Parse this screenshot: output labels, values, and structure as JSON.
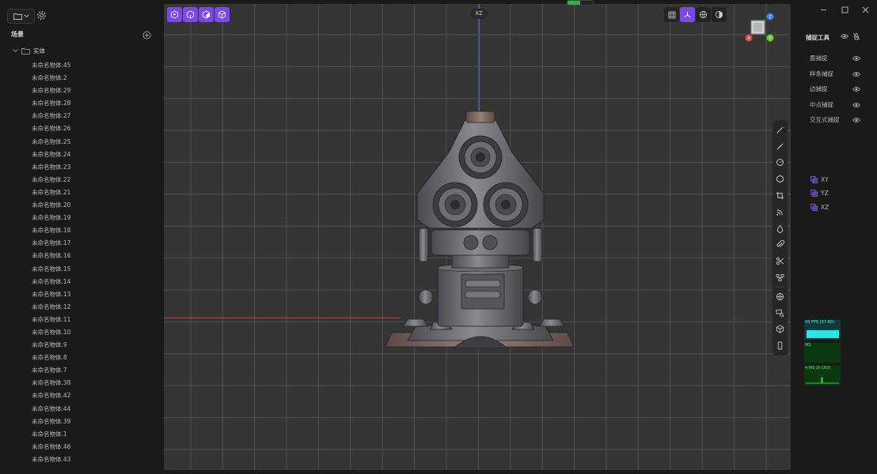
{
  "left_panel": {
    "title": "场景",
    "root_label": "实体",
    "objects": [
      "未命名物体.45",
      "未命名物体.2",
      "未命名物体.29",
      "未命名物体.28",
      "未命名物体.27",
      "未命名物体.26",
      "未命名物体.25",
      "未命名物体.24",
      "未命名物体.23",
      "未命名物体.22",
      "未命名物体.21",
      "未命名物体.20",
      "未命名物体.19",
      "未命名物体.18",
      "未命名物体.17",
      "未命名物体.16",
      "未命名物体.15",
      "未命名物体.14",
      "未命名物体.13",
      "未命名物体.12",
      "未命名物体.11",
      "未命名物体.10",
      "未命名物体.9",
      "未命名物体.8",
      "未命名物体.7",
      "未命名物体.38",
      "未命名物体.42",
      "未命名物体.44",
      "未命名物体.39",
      "未命名物体.1",
      "未命名物体.46",
      "未命名物体.43"
    ]
  },
  "viewport": {
    "view_label": "XZ",
    "loading_progress": 0.5
  },
  "gizmo": {
    "z": "Z",
    "x": "X",
    "y": "Y"
  },
  "snap_panel": {
    "title": "捕捉工具",
    "items": [
      "面捕捉",
      "样条捕捉",
      "边捕捉",
      "中点捕捉",
      "交互式捕捉"
    ],
    "planes": [
      "XY",
      "YZ",
      "XZ"
    ]
  },
  "stats": {
    "fps": "43 FPS (37-60)",
    "ms": "MS",
    "mb": "4 MS (0-163)"
  },
  "colors": {
    "accent": "#7b4ae6",
    "x_axis": "#c83c3c",
    "z_axis": "#3a5ef2",
    "y_axis": "#5bd12b"
  }
}
